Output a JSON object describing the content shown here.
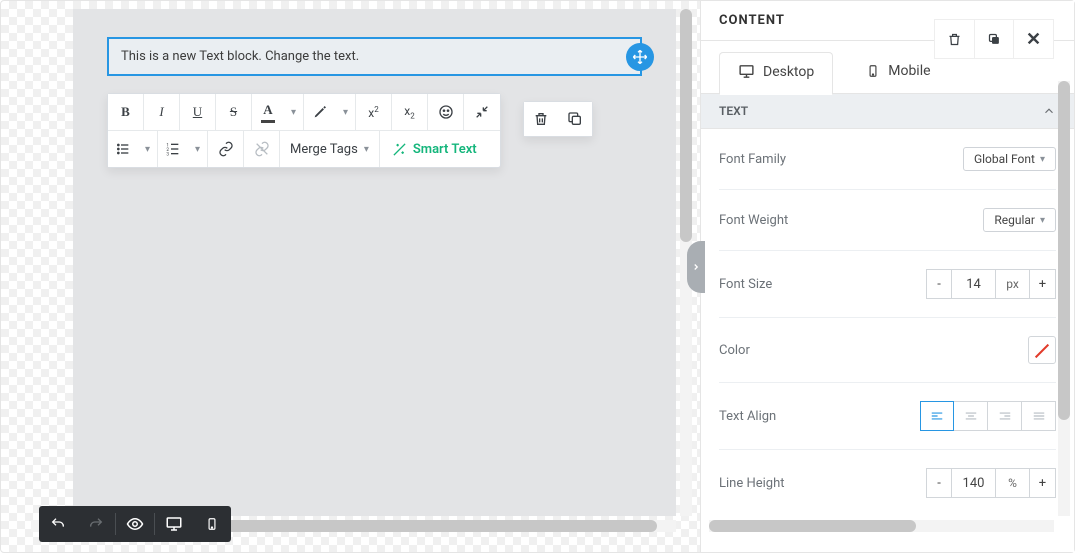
{
  "canvas": {
    "text_block": "This is a new Text block. Change the text."
  },
  "toolbar": {
    "merge_tags": "Merge Tags",
    "smart_text": "Smart Text"
  },
  "panel": {
    "title": "CONTENT",
    "tabs": {
      "desktop": "Desktop",
      "mobile": "Mobile"
    },
    "section": "TEXT",
    "font_family": {
      "label": "Font Family",
      "value": "Global Font"
    },
    "font_weight": {
      "label": "Font Weight",
      "value": "Regular"
    },
    "font_size": {
      "label": "Font Size",
      "value": "14",
      "unit": "px",
      "minus": "-",
      "plus": "+"
    },
    "color": {
      "label": "Color"
    },
    "text_align": {
      "label": "Text Align"
    },
    "line_height": {
      "label": "Line Height",
      "value": "140",
      "unit": "%",
      "minus": "-",
      "plus": "+"
    }
  }
}
